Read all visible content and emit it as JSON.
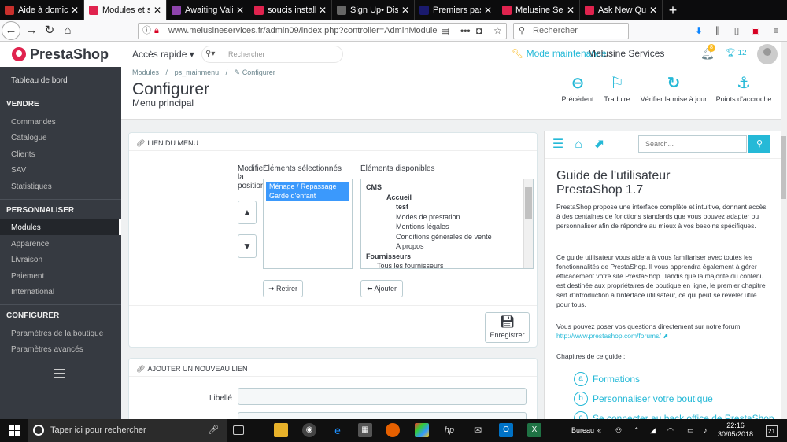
{
  "browser": {
    "tabs": [
      {
        "title": "Aide à domicile",
        "color": "#c9302c"
      },
      {
        "title": "Modules et serv",
        "color": "#e0234e"
      },
      {
        "title": "Awaiting Valida",
        "color": "#8e44ad"
      },
      {
        "title": "soucis installati",
        "color": "#e0234e"
      },
      {
        "title": "Sign Up• Displ",
        "color": "#666666"
      },
      {
        "title": "Premiers pas av",
        "color": "#1a1a6e"
      },
      {
        "title": "Melusine Servic",
        "color": "#e0234e"
      },
      {
        "title": "Ask New Quest",
        "color": "#e0234e"
      }
    ],
    "url": "www.melusineservices.fr/admin09/index.php?controller=AdminModule",
    "search_placeholder": "Rechercher",
    "dots": "•••"
  },
  "sidebar": {
    "logo": "PrestaShop",
    "dashboard": "Tableau de bord",
    "sections": [
      {
        "title": "VENDRE",
        "items": [
          "Commandes",
          "Catalogue",
          "Clients",
          "SAV",
          "Statistiques"
        ]
      },
      {
        "title": "PERSONNALISER",
        "items": [
          "Modules",
          "Apparence",
          "Livraison",
          "Paiement",
          "International"
        ]
      },
      {
        "title": "CONFIGURER",
        "items": [
          "Paramètres de la boutique",
          "Paramètres avancés"
        ]
      }
    ],
    "active_item": "Modules"
  },
  "topbar": {
    "quick_access": "Accès rapide",
    "search_placeholder": "Rechercher",
    "maintenance": "Mode maintenance",
    "shop_name": "Melusine Services",
    "notif_count": "8",
    "trophy_count": "12"
  },
  "header": {
    "breadcrumb": [
      "Modules",
      "ps_mainmenu",
      "Configurer"
    ],
    "title": "Configurer",
    "subtitle": "Menu principal",
    "toolbar": [
      "Précédent",
      "Traduire",
      "Vérifier la mise à jour",
      "Points d'accroche"
    ]
  },
  "panel1": {
    "heading": "LIEN DU MENU",
    "modify_label": "Modifier la position",
    "selected_label": "Éléments sélectionnés",
    "available_label": "Éléments disponibles",
    "selected_items": [
      "Ménage / Repassage",
      "Garde d'enfant"
    ],
    "available_items": [
      {
        "text": "CMS",
        "level": 0,
        "bold": true
      },
      {
        "text": "Accueil",
        "level": 2,
        "bold": true
      },
      {
        "text": "test",
        "level": 3,
        "bold": true
      },
      {
        "text": "Modes de prestation",
        "level": 3,
        "bold": false
      },
      {
        "text": "Mentions légales",
        "level": 3,
        "bold": false
      },
      {
        "text": "Conditions générales de vente",
        "level": 3,
        "bold": false
      },
      {
        "text": "A propos",
        "level": 3,
        "bold": false
      },
      {
        "text": "Fournisseurs",
        "level": 0,
        "bold": true
      },
      {
        "text": "Tous les fournisseurs",
        "level": 1,
        "bold": false
      }
    ],
    "remove": "Retirer",
    "add": "Ajouter",
    "save": "Enregistrer"
  },
  "panel2": {
    "heading": "AJOUTER UN NOUVEAU LIEN",
    "label_field": "Libellé",
    "label_value": ""
  },
  "help": {
    "search_placeholder": "Search...",
    "title_line1": "Guide de l'utilisateur",
    "title_line2": "PrestaShop 1.7",
    "p1": "PrestaShop propose une interface complète et intuitive, donnant accès à des centaines de fonctions standards que vous pouvez adapter ou personnaliser afin de répondre au mieux à vos besoins spécifiques.",
    "p2": "Ce guide utilisateur vous aidera à vous familiariser avec toutes les fonctionnalités de PrestaShop. Il vous apprendra également à gérer efficacement votre site PrestaShop. Tandis que la majorité du contenu est destinée aux propriétaires de boutique en ligne, le premier chapitre sert d'introduction à l'interface utilisateur, ce qui peut se révéler utile pour tous.",
    "p3": "Vous pouvez poser vos questions directement sur notre forum,",
    "forum_link": "http://www.prestashop.com/forums/",
    "chapters_label": "Chapitres de ce guide :",
    "chapters": [
      {
        "letter": "a",
        "title": "Formations"
      },
      {
        "letter": "b",
        "title": "Personnaliser votre boutique"
      },
      {
        "letter": "c",
        "title": "Se connecter au back office de PrestaShop"
      }
    ]
  },
  "taskbar": {
    "search": "Taper ici pour rechercher",
    "desktop_label": "Bureau",
    "time": "22:16",
    "date": "30/05/2018",
    "notif": "21"
  }
}
